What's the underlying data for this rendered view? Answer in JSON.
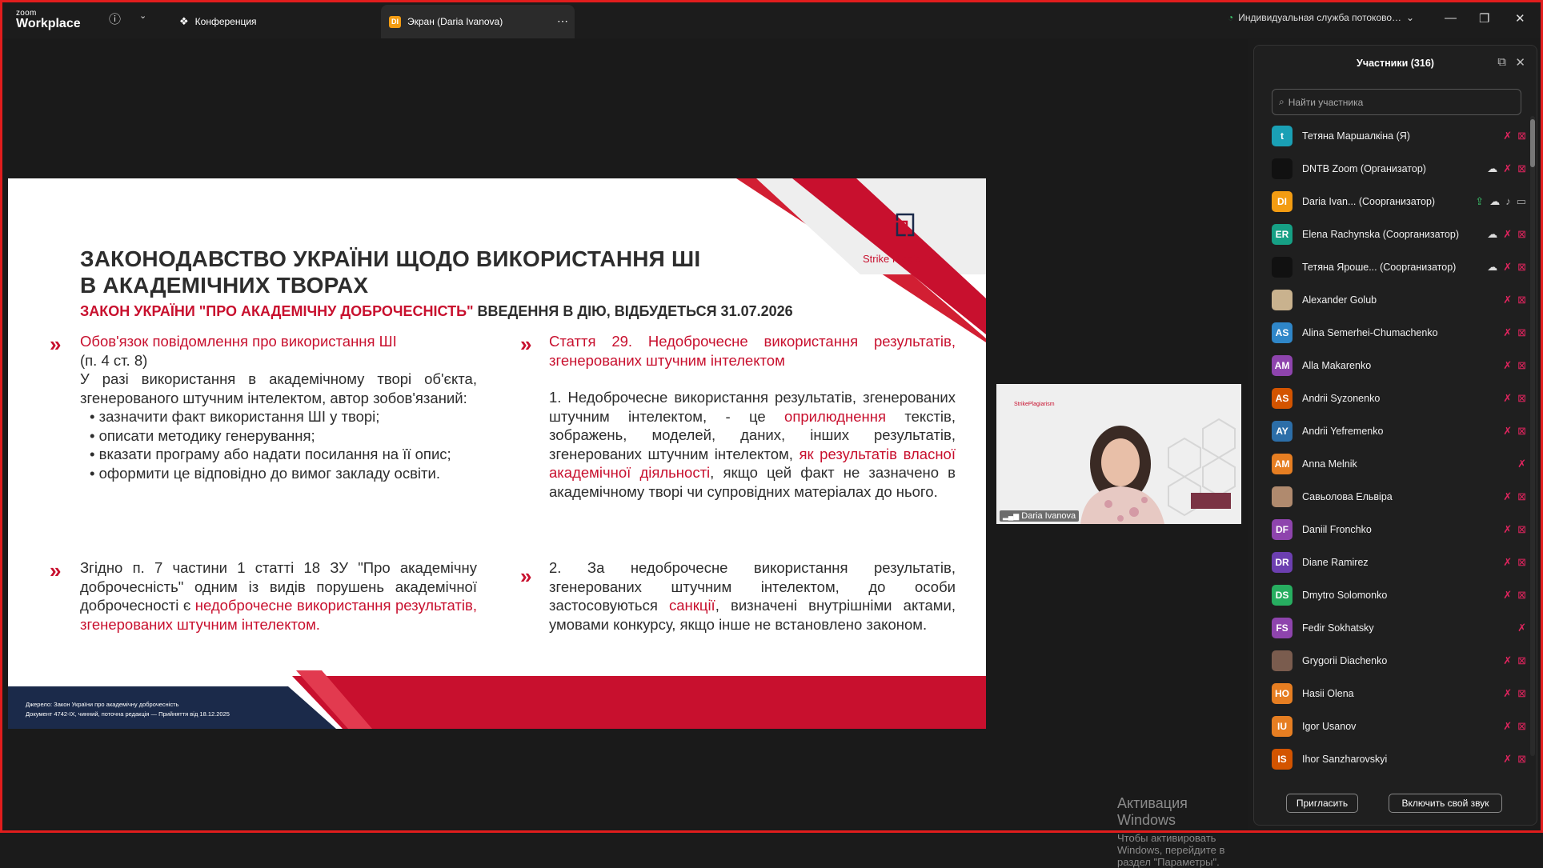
{
  "app": {
    "logo_small": "zoom",
    "logo_big": "Workplace"
  },
  "tabs": [
    {
      "label": "Конференция",
      "icon": "paw-icon"
    },
    {
      "label": "Экран (Daria Ivanova)",
      "badge": "DI"
    }
  ],
  "titlebar_right": {
    "service": "Индивидуальная служба потоково…"
  },
  "slide": {
    "title": "ЗАКОНОДАВСТВО УКРАЇНИ ЩОДО ВИКОРИСТАННЯ ШІ В АКАДЕМІЧНИХ ТВОРАХ",
    "subtitle_red": "ЗАКОН УКРАЇНИ \"ПРО АКАДЕМІЧНУ ДОБРОЧЕСНІСТЬ\"",
    "subtitle_dark": " ВВЕДЕННЯ В ДІЮ, ВІДБУДЕТЬСЯ 31.07.2026",
    "brand": "Strike Plagiarism",
    "left_block1": {
      "heading": "Обов'язок повідомлення про використання ШІ",
      "ref": "(п. 4 ст. 8)",
      "text": "У разі використання в академічному творі об'єкта, згенерованого штучним інтелектом, автор зобов'язаний:",
      "bullets": [
        "• зазначити факт використання ШІ у творі;",
        "• описати методику генерування;",
        "• вказати програму або надати посилання на її опис;",
        "• оформити це відповідно до вимог закладу освіти."
      ]
    },
    "left_block2": {
      "text": "Згідно п. 7 частини 1 статті 18 ЗУ \"Про академічну доброчесність\" одним із видів порушень академічної доброчесності є ",
      "red": "недоброчесне використання результатів, згенерованих штучним інтелектом."
    },
    "right_block1": {
      "heading": "Стаття 29. Недоброчесне використання результатів, згенерованих штучним інтелектом",
      "p1": "1. Недоброчесне використання результатів, згенерованих штучним інтелектом, - це ",
      "r1": "оприлюднення",
      "p2": " текстів, зображень, моделей, даних, інших результатів, згенерованих штучним інтелектом, ",
      "r2": "як результатів власної академічної діяльності",
      "p3": ", якщо цей факт не зазначено в академічному творі чи супровідних матеріалах до нього."
    },
    "right_block2": {
      "p1": "2. За недоброчесне використання результатів, згенерованих штучним інтелектом, до особи застосовуються ",
      "r1": "санкції",
      "p2": ", визначені внутрішніми актами, умовами конкурсу, якщо інше не встановлено законом."
    },
    "footer_line1": "Джерело: Закон України про академічну доброчесність",
    "footer_line2": "Документ 4742-IX, чинний, поточна редакція — Прийняття від 18.12.2025"
  },
  "video": {
    "name": "Daria Ivanova",
    "brand": "StrikePlagiarism"
  },
  "watermark": {
    "line1": "Активация Windows",
    "line2": "Чтобы активировать Windows, перейдите в раздел \"Параметры\"."
  },
  "panel": {
    "title": "Участники (316)",
    "search_placeholder": "Найти участника",
    "participants": [
      {
        "initials": "t",
        "color": "#1aa0b5",
        "name": "Тетяна Маршалкіна (Я)",
        "icons": [
          "mic-off",
          "cam-off"
        ]
      },
      {
        "initials": "",
        "color": "#111111",
        "name": "DNTB Zoom (Организатор)",
        "icons": [
          "cloud",
          "mic-off",
          "cam-off"
        ]
      },
      {
        "initials": "DI",
        "color": "#f39c12",
        "name": "Daria Ivan... (Соорганизатор)",
        "icons": [
          "share",
          "cloud",
          "mic-on",
          "cam-on"
        ]
      },
      {
        "initials": "ER",
        "color": "#16a085",
        "name": "Elena Rachynska (Соорганизатор)",
        "icons": [
          "cloud",
          "mic-off",
          "cam-off"
        ]
      },
      {
        "initials": "",
        "color": "#111111",
        "name": "Тетяна Ярошe... (Соорганизатор)",
        "icons": [
          "cloud",
          "mic-off",
          "cam-off"
        ]
      },
      {
        "initials": "",
        "color": "#c9b28e",
        "name": "Alexander Golub",
        "icons": [
          "mic-off",
          "cam-off"
        ]
      },
      {
        "initials": "AS",
        "color": "#2f86c8",
        "name": "Alina Semerhei-Chumachenko",
        "icons": [
          "mic-off",
          "cam-off"
        ]
      },
      {
        "initials": "AM",
        "color": "#8e44ad",
        "name": "Alla Makarenko",
        "icons": [
          "mic-off",
          "cam-off"
        ]
      },
      {
        "initials": "AS",
        "color": "#d35400",
        "name": "Andrii Syzonenko",
        "icons": [
          "mic-off",
          "cam-off"
        ]
      },
      {
        "initials": "AY",
        "color": "#2c6ea8",
        "name": "Andrii Yefremenko",
        "icons": [
          "mic-off",
          "cam-off"
        ]
      },
      {
        "initials": "AM",
        "color": "#e67e22",
        "name": "Anna Melnik",
        "icons": [
          "mic-off"
        ]
      },
      {
        "initials": "",
        "color": "#b08a6e",
        "name": "Савьолова Ельвіра",
        "icons": [
          "mic-off",
          "cam-off"
        ]
      },
      {
        "initials": "DF",
        "color": "#8e44ad",
        "name": "Daniil Fronchko",
        "icons": [
          "mic-off",
          "cam-off"
        ]
      },
      {
        "initials": "DR",
        "color": "#6c3fb0",
        "name": "Diane Ramirez",
        "icons": [
          "mic-off",
          "cam-off"
        ]
      },
      {
        "initials": "DS",
        "color": "#27ae60",
        "name": "Dmytro Solomonko",
        "icons": [
          "mic-off",
          "cam-off"
        ]
      },
      {
        "initials": "FS",
        "color": "#8e44ad",
        "name": "Fedir Sokhatsky",
        "icons": [
          "mic-off"
        ]
      },
      {
        "initials": "",
        "color": "#7a5c4e",
        "name": "Grygorii Diachenko",
        "icons": [
          "mic-off",
          "cam-off"
        ]
      },
      {
        "initials": "HO",
        "color": "#e67e22",
        "name": "Hasii Olena",
        "icons": [
          "mic-off",
          "cam-off"
        ]
      },
      {
        "initials": "IU",
        "color": "#e67e22",
        "name": "Igor Usanov",
        "icons": [
          "mic-off",
          "cam-off"
        ]
      },
      {
        "initials": "IS",
        "color": "#d35400",
        "name": "Ihor Sanzharovskyi",
        "icons": [
          "mic-off",
          "cam-off"
        ]
      }
    ],
    "invite_button": "Пригласить",
    "unmute_button": "Включить свой звук"
  }
}
